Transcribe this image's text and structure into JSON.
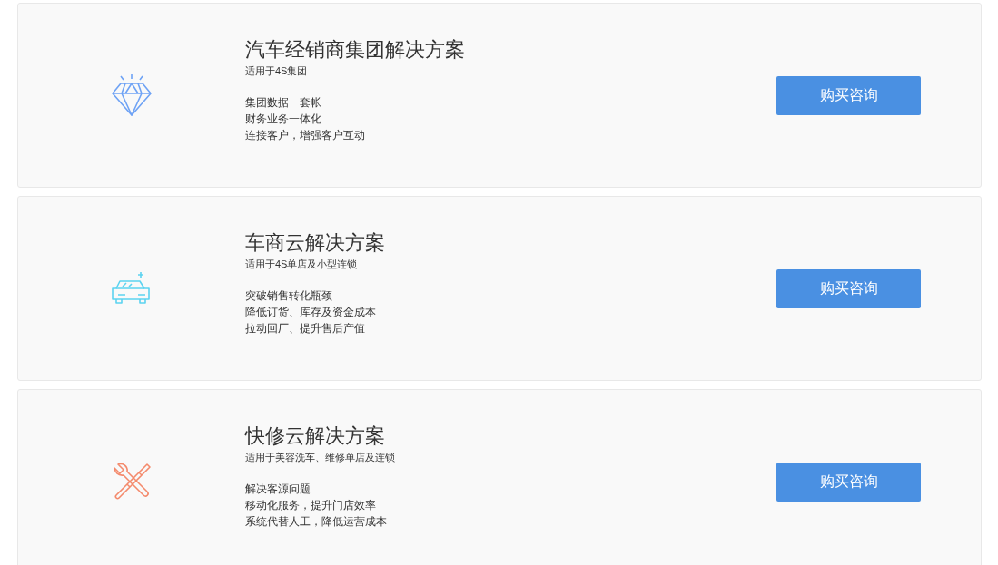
{
  "solutions": [
    {
      "kind": "diamond",
      "title": "汽车经销商集团解决方案",
      "subtitle": "适用于4S集团",
      "features": [
        "集团数据一套帐",
        "财务业务一体化",
        "连接客户，增强客户互动"
      ],
      "button": "购买咨询"
    },
    {
      "kind": "car",
      "title": "车商云解决方案",
      "subtitle": "适用于4S单店及小型连锁",
      "features": [
        "突破销售转化瓶颈",
        "降低订货、库存及资金成本",
        "拉动回厂、提升售后产值"
      ],
      "button": "购买咨询"
    },
    {
      "kind": "tools",
      "title": "快修云解决方案",
      "subtitle": "适用于美容洗车、维修单店及连锁",
      "features": [
        "解决客源问题",
        "移动化服务，提升门店效率",
        "系统代替人工，降低运营成本"
      ],
      "button": "购买咨询"
    }
  ]
}
